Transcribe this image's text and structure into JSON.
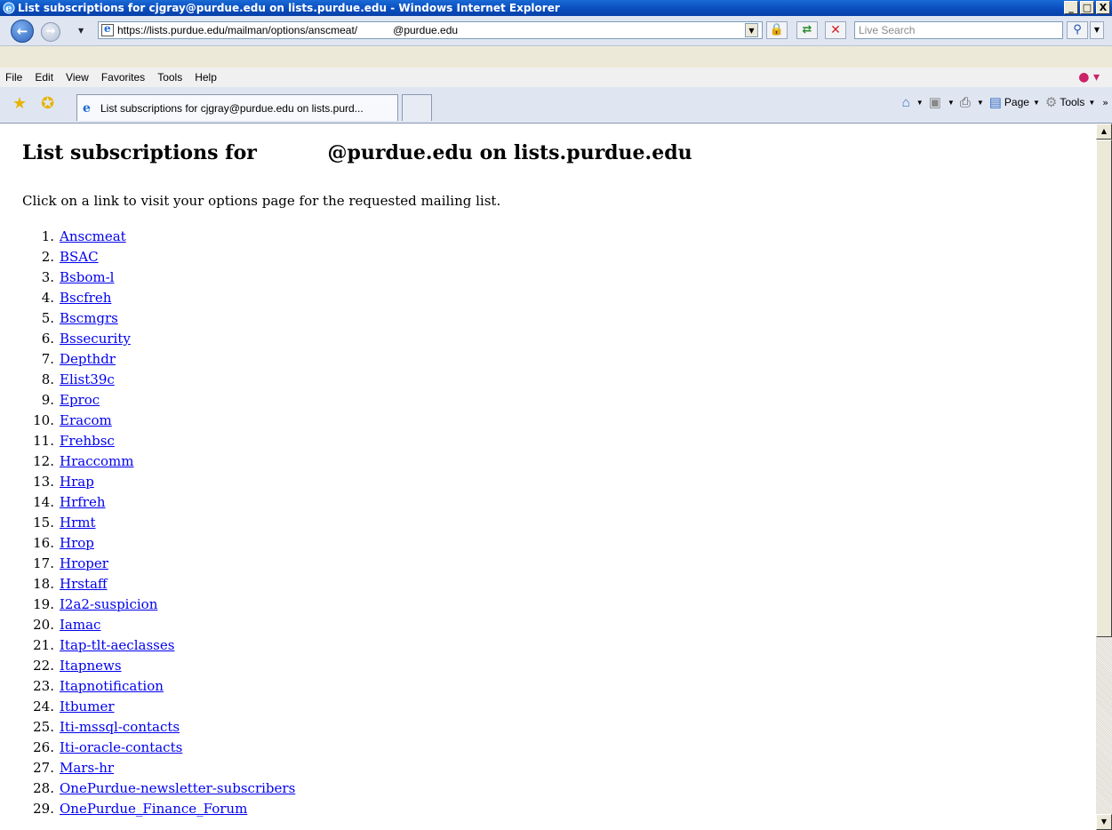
{
  "window": {
    "title": "List subscriptions for cjgray@purdue.edu on lists.purdue.edu - Windows Internet Explorer",
    "min": "_",
    "max": "□",
    "close": "X"
  },
  "address": {
    "url_prefix": "https://lists.purdue.edu/mailman/options/anscmeat/",
    "url_suffix": "@purdue.edu",
    "search_placeholder": "Live Search"
  },
  "menu": [
    "File",
    "Edit",
    "View",
    "Favorites",
    "Tools",
    "Help"
  ],
  "tab": {
    "label": "List subscriptions for cjgray@purdue.edu on lists.purd..."
  },
  "command_bar": {
    "page": "Page",
    "tools": "Tools"
  },
  "page": {
    "heading_prefix": "List subscriptions for ",
    "heading_suffix": "@purdue.edu on lists.purdue.edu",
    "intro": "Click on a link to visit your options page for the requested mailing list.",
    "lists": [
      {
        "num": "1.",
        "name": "Anscmeat"
      },
      {
        "num": "2.",
        "name": "BSAC"
      },
      {
        "num": "3.",
        "name": "Bsbom-l"
      },
      {
        "num": "4.",
        "name": "Bscfreh"
      },
      {
        "num": "5.",
        "name": "Bscmgrs"
      },
      {
        "num": "6.",
        "name": "Bssecurity"
      },
      {
        "num": "7.",
        "name": "Depthdr"
      },
      {
        "num": "8.",
        "name": "Elist39c"
      },
      {
        "num": "9.",
        "name": "Eproc"
      },
      {
        "num": "10.",
        "name": "Eracom"
      },
      {
        "num": "11.",
        "name": "Frehbsc"
      },
      {
        "num": "12.",
        "name": "Hraccomm"
      },
      {
        "num": "13.",
        "name": "Hrap"
      },
      {
        "num": "14.",
        "name": "Hrfreh"
      },
      {
        "num": "15.",
        "name": "Hrmt"
      },
      {
        "num": "16.",
        "name": "Hrop"
      },
      {
        "num": "17.",
        "name": "Hroper"
      },
      {
        "num": "18.",
        "name": "Hrstaff"
      },
      {
        "num": "19.",
        "name": "I2a2-suspicion"
      },
      {
        "num": "20.",
        "name": "Iamac"
      },
      {
        "num": "21.",
        "name": "Itap-tlt-aeclasses"
      },
      {
        "num": "22.",
        "name": "Itapnews"
      },
      {
        "num": "23.",
        "name": "Itapnotification"
      },
      {
        "num": "24.",
        "name": "Itbumer"
      },
      {
        "num": "25.",
        "name": "Iti-mssql-contacts"
      },
      {
        "num": "26.",
        "name": "Iti-oracle-contacts"
      },
      {
        "num": "27.",
        "name": "Mars-hr"
      },
      {
        "num": "28.",
        "name": "OnePurdue-newsletter-subscribers"
      },
      {
        "num": "29.",
        "name": "OnePurdue_Finance_Forum"
      }
    ]
  }
}
